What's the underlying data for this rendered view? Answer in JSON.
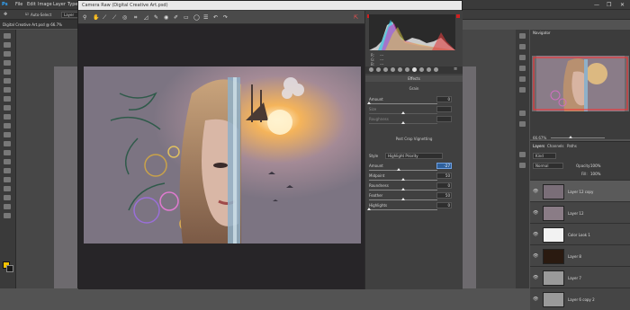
{
  "menubar": {
    "items": [
      "File",
      "Edit",
      "Image",
      "Layer",
      "Type"
    ],
    "window_controls": [
      "—",
      "❐",
      "✕"
    ]
  },
  "optionsbar": {
    "auto_select_label": "Auto-Select",
    "layer_label": "Layer"
  },
  "doc_tab": {
    "label": "Digital Creative Art.psd @ 66.7%"
  },
  "camera_raw": {
    "title": "Camera Raw (Digital Creative Art.psd)",
    "toolbar_icons": [
      "zoom-icon",
      "hand-icon",
      "white-balance-icon",
      "color-sampler-icon",
      "targeted-adjust-icon",
      "crop-icon",
      "straighten-icon",
      "spot-removal-icon",
      "red-eye-icon",
      "adjustment-brush-icon",
      "graduated-filter-icon",
      "radial-filter-icon",
      "preferences-icon",
      "rotate-ccw-icon",
      "rotate-cw-icon"
    ],
    "rgb": {
      "r": "R:",
      "g": "G:",
      "b": "B:",
      "dash": "---"
    },
    "effects_header": "Effects",
    "grain": {
      "title": "Grain",
      "sliders": [
        {
          "label": "Amount",
          "value": "0",
          "pos": 0.0,
          "dim": false
        },
        {
          "label": "Size",
          "value": "",
          "pos": 0.5,
          "dim": true
        },
        {
          "label": "Roughness",
          "value": "",
          "pos": 0.5,
          "dim": true
        }
      ]
    },
    "vignette": {
      "title": "Post Crop Vignetting",
      "style_label": "Style",
      "style_value": "Highlight Priority",
      "sliders": [
        {
          "label": "Amount",
          "value": "-27",
          "pos": 0.43,
          "active": true
        },
        {
          "label": "Midpoint",
          "value": "50",
          "pos": 0.5,
          "active": false
        },
        {
          "label": "Roundness",
          "value": "0",
          "pos": 0.5,
          "active": false
        },
        {
          "label": "Feather",
          "value": "50",
          "pos": 0.5,
          "active": false
        },
        {
          "label": "Highlights",
          "value": "0",
          "pos": 0.0,
          "active": false
        }
      ]
    }
  },
  "navigator": {
    "tab": "Navigator",
    "zoom": "66.67%"
  },
  "layers": {
    "tabs": [
      "Layers",
      "Channels",
      "Paths"
    ],
    "kind_label": "Kind",
    "blend_mode": "Normal",
    "opacity_label": "Opacity:",
    "opacity_value": "100%",
    "fill_label": "Fill:",
    "fill_value": "100%",
    "rows": [
      {
        "name": "Layer 12 copy",
        "selected": true
      },
      {
        "name": "Layer 12",
        "selected": false
      },
      {
        "name": "Color Look 1",
        "selected": false
      },
      {
        "name": "Layer 8",
        "selected": false
      },
      {
        "name": "Layer 7",
        "selected": false
      },
      {
        "name": "Layer 6 copy 2",
        "selected": false
      }
    ]
  },
  "colors": {
    "accent": "#2e5f9a",
    "dialog_bg": "#3c3c3c",
    "preview_bg": "#272528"
  }
}
